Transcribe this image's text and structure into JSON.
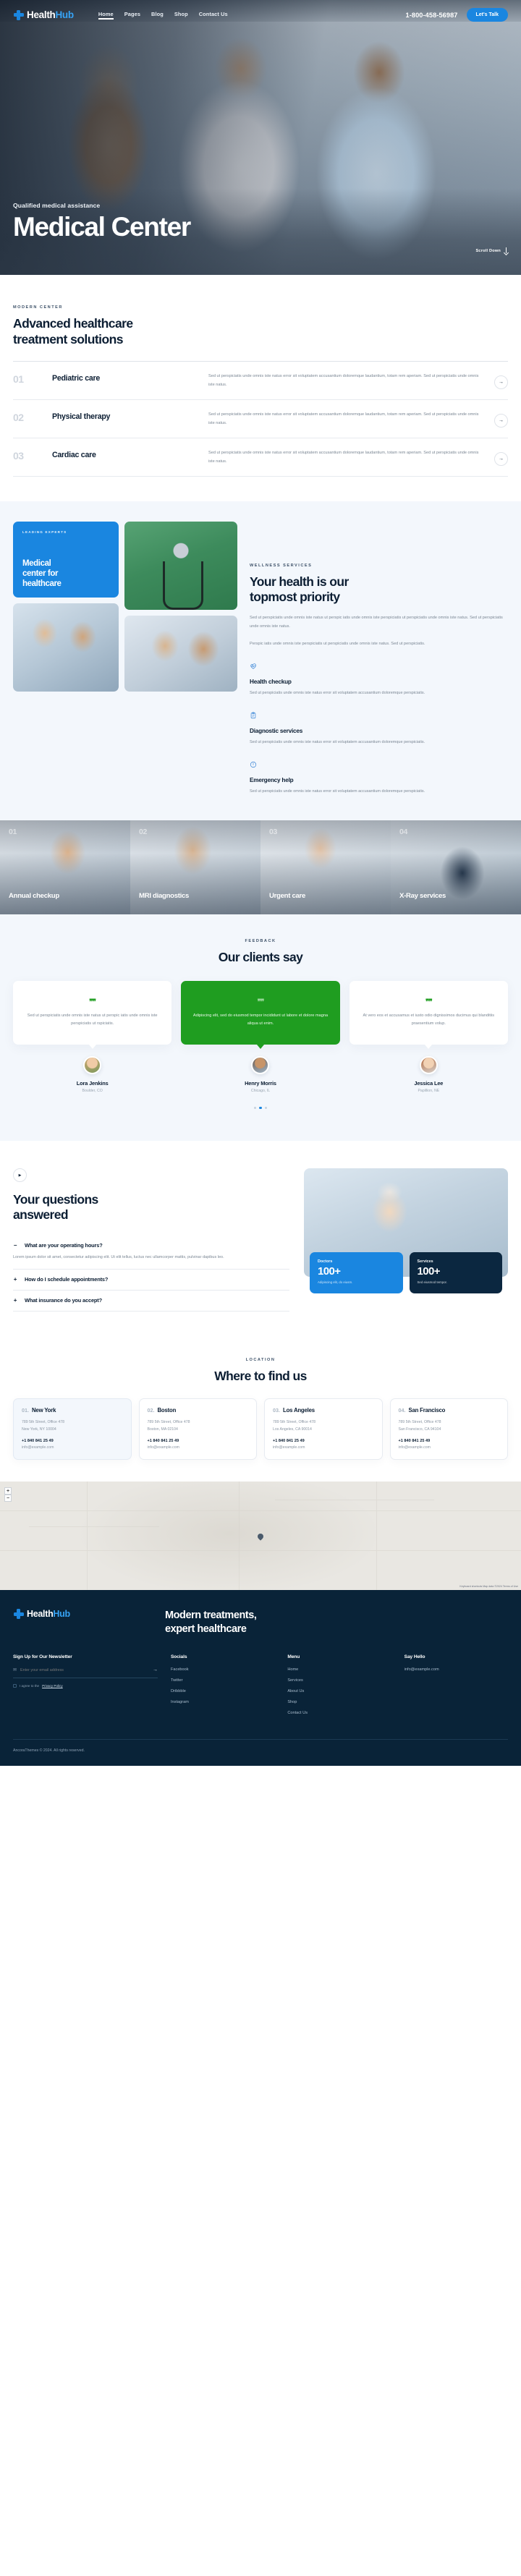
{
  "brand": {
    "name_a": "Health",
    "name_b": "Hub",
    "logo_icon": "medical-cross-icon"
  },
  "nav": {
    "links": [
      {
        "label": "Home",
        "active": true
      },
      {
        "label": "Pages",
        "active": false
      },
      {
        "label": "Blog",
        "active": false
      },
      {
        "label": "Shop",
        "active": false
      },
      {
        "label": "Contact Us",
        "active": false
      }
    ],
    "phone": "1-800-458-56987",
    "cta_label": "Let's Talk"
  },
  "hero": {
    "kicker": "Qualified medical assistance",
    "title": "Medical Center",
    "scroll_label": "Scroll Down"
  },
  "services": {
    "kicker": "MODERN CENTER",
    "title_line1": "Advanced healthcare",
    "title_line2": "treatment solutions",
    "items": [
      {
        "num": "01",
        "title": "Pediatric care",
        "desc": "Sed ut perspiciatis unde omnis iste natus error sit voluptatem accusantium doloremque laudantium, totam rem aperiam. Sed ut perspiciatis unde omnis iste natus.",
        "arrow": "→"
      },
      {
        "num": "02",
        "title": "Physical therapy",
        "desc": "Sed ut perspiciatis unde omnis iste natus error sit voluptatem accusantium doloremque laudantium, totam rem aperiam. Sed ut perspiciatis unde omnis iste natus.",
        "arrow": "→"
      },
      {
        "num": "03",
        "title": "Cardiac care",
        "desc": "Sed ut perspiciatis unde omnis iste natus error sit voluptatem accusantium doloremque laudantium, totam rem aperiam. Sed ut perspiciatis unde omnis iste natus.",
        "arrow": "→"
      }
    ]
  },
  "wellness": {
    "card": {
      "kicker": "LEADING EXPERTS",
      "title_line1": "Medical",
      "title_line2": "center for",
      "title_line3": "healthcare"
    },
    "kicker": "WELLNESS SERVICES",
    "title_line1": "Your health is our",
    "title_line2": "topmost priority",
    "para1": "Sed ut perspiciatis unde omnis iste natus ut perspic iatis unde omnis iste perspiciatis ut perspiciatis unde omnis iste natus. Sed ut perspiciatis unde omnis iste natus.",
    "para2": "Perspic iatis unde omnis iste perspiciatis ut perspiciatis unde omnis iste natus. Sed ut perspiciatis.",
    "features": [
      {
        "icon": "heart-pulse-icon",
        "title": "Health checkup",
        "desc": "Sed ut perspiciatis unde omnis iste natus error sit voluptatem accusantium doloremque perspiciatis."
      },
      {
        "icon": "clipboard-report-icon",
        "title": "Diagnostic services",
        "desc": "Sed ut perspiciatis unde omnis iste natus error sit voluptatem accusantium doloremque perspiciatis."
      },
      {
        "icon": "ambulance-alert-icon",
        "title": "Emergency help",
        "desc": "Sed ut perspiciatis unde omnis iste natus error sit voluptatem accusantium doloremque perspiciatis."
      }
    ]
  },
  "gallery": {
    "items": [
      {
        "num": "01",
        "label": "Annual checkup"
      },
      {
        "num": "02",
        "label": "MRI diagnostics"
      },
      {
        "num": "03",
        "label": "Urgent care"
      },
      {
        "num": "04",
        "label": "X-Ray services"
      }
    ]
  },
  "testimonials": {
    "kicker": "FEEDBACK",
    "title": "Our clients say",
    "items": [
      {
        "quote_icon": "quote-icon",
        "text": "Sed ut perspiciatis unde omnis iste natus ut perspic iatis unde omnis iste perspiciatis ut rspiciatis.",
        "name": "Lora Jenkins",
        "location": "Boulder, CO",
        "highlight": false
      },
      {
        "quote_icon": "quote-icon",
        "text": "Adipiscing elit, sed do eiusmod tempor incididunt ut labore et dolore magna aliqua ut enim.",
        "name": "Henry Morris",
        "location": "Chicago, IL",
        "highlight": true
      },
      {
        "quote_icon": "quote-icon",
        "text": "At vero eos et accusamus et iusto odio dignissimos ducimus qui blanditiis praesentium volup.",
        "name": "Jessica Lee",
        "location": "Papillion, NE",
        "highlight": false
      }
    ],
    "dots": 3,
    "active_dot": 1
  },
  "faq": {
    "play_icon": "play-icon",
    "title_line1": "Your questions",
    "title_line2": "answered",
    "items": [
      {
        "sign": "−",
        "question": "What are your operating hours?",
        "answer": "Lorem ipsum dolor sit amet, consectetur adipiscing elit. Ut elit tellus, luctus nec ullamcorper mattis, pulvinar dapibus leo.",
        "open": true
      },
      {
        "sign": "+",
        "question": "How do I schedule appointments?",
        "answer": "",
        "open": false
      },
      {
        "sign": "+",
        "question": "What insurance do you accept?",
        "answer": "",
        "open": false
      }
    ],
    "stats": [
      {
        "label": "Doctors",
        "value": "100+",
        "sub": "Adipiscing elit, do eiusm.",
        "color": "#1a86e0"
      },
      {
        "label": "Services",
        "value": "100+",
        "sub": "Sed eiusmod tempor.",
        "color": "#0b2740"
      }
    ]
  },
  "locations": {
    "kicker": "LOCATION",
    "title": "Where to find us",
    "cards": [
      {
        "index": "01.",
        "city": "New York",
        "address_line1": "789 5th Street, Office 478",
        "address_line2": "New York, NY 10004",
        "phone": "+1 840 841 25 49",
        "email": "info@example.com"
      },
      {
        "index": "02.",
        "city": "Boston",
        "address_line1": "789 5th Street, Office 478",
        "address_line2": "Boston, MA 02104",
        "phone": "+1 840 841 25 49",
        "email": "info@example.com"
      },
      {
        "index": "03.",
        "city": "Los Angeles",
        "address_line1": "789 5th Street, Office 478",
        "address_line2": "Los Angeles, CA 90014",
        "phone": "+1 840 841 25 49",
        "email": "info@example.com"
      },
      {
        "index": "04.",
        "city": "San Francisco",
        "address_line1": "789 5th Street, Office 478",
        "address_line2": "San Francisco, CA 94104",
        "phone": "+1 840 841 25 49",
        "email": "info@example.com"
      }
    ]
  },
  "map": {
    "pin_icon": "map-pin-icon",
    "zoom_in": "+",
    "zoom_out": "−",
    "credit": "Keyboard shortcuts  Map data ©2024  Terms of Use"
  },
  "footer": {
    "tagline_line1": "Modern treatments,",
    "tagline_line2": "expert healthcare",
    "newsletter": {
      "title": "Sign Up for Our Newsletter",
      "mail_icon": "envelope-icon",
      "placeholder": "Enter your email address",
      "submit_icon": "→",
      "consent_pre": "I agree to the",
      "consent_link": "Privacy Policy"
    },
    "socials": {
      "title": "Socials",
      "links": [
        "Facebook",
        "Twitter",
        "Dribbble",
        "Instagram"
      ]
    },
    "menu": {
      "title": "Menu",
      "links": [
        "Home",
        "Services",
        "About Us",
        "Shop",
        "Contact Us"
      ]
    },
    "sayhello": {
      "title": "Say Hello",
      "email": "info@example.com"
    },
    "copyright": "AncoraThemes © 2024. All rights reserved."
  }
}
